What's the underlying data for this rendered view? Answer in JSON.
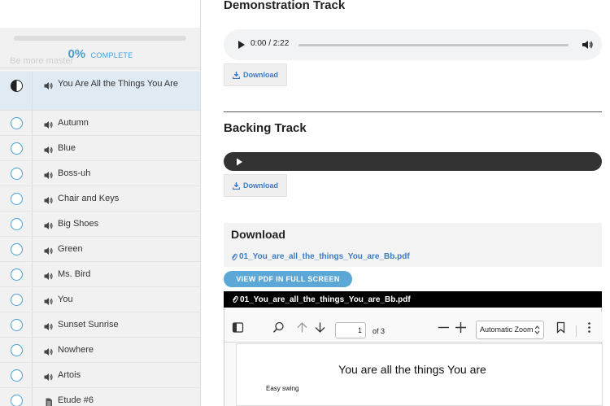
{
  "sidebar": {
    "progress_ghost": "Be more master",
    "progress_percent": "0%",
    "progress_word": "COMPLETE",
    "progress_value": 0,
    "lessons": [
      {
        "title": "You Are All the Things You Are",
        "icon": "speaker-icon",
        "active": true
      },
      {
        "title": "Autumn",
        "icon": "speaker-icon"
      },
      {
        "title": "Blue",
        "icon": "speaker-icon"
      },
      {
        "title": "Boss-uh",
        "icon": "speaker-icon"
      },
      {
        "title": "Chair and Keys",
        "icon": "speaker-icon"
      },
      {
        "title": "Big Shoes",
        "icon": "speaker-icon"
      },
      {
        "title": "Green",
        "icon": "speaker-icon"
      },
      {
        "title": "Ms. Bird",
        "icon": "speaker-icon"
      },
      {
        "title": "You",
        "icon": "speaker-icon"
      },
      {
        "title": "Sunset Sunrise",
        "icon": "speaker-icon"
      },
      {
        "title": "Nowhere",
        "icon": "speaker-icon"
      },
      {
        "title": "Artois",
        "icon": "speaker-icon"
      },
      {
        "title": "Etude #6",
        "icon": "document-icon"
      }
    ]
  },
  "main": {
    "demo_heading": "Demonstration Track",
    "demo_time": "0:00 / 2:22",
    "demo_progress": 0,
    "download_label": "Download",
    "backing_heading": "Backing Track",
    "download_section_heading": "Download",
    "pdf_filename": "01_You_are_all_the_things_You_are_Bb.pdf",
    "view_pdf_label": "VIEW PDF IN FULL SCREEN",
    "pdf_viewer": {
      "page_number": "1",
      "page_of": "of 3",
      "zoom": "Automatic Zoom",
      "song_title": "You are all the things You are",
      "style_mark": "Easy swing"
    }
  },
  "colors": {
    "accent": "#4a9fd0",
    "link": "#3d7bc0",
    "button": "#5ba7d6",
    "dark_player": "#333333"
  }
}
